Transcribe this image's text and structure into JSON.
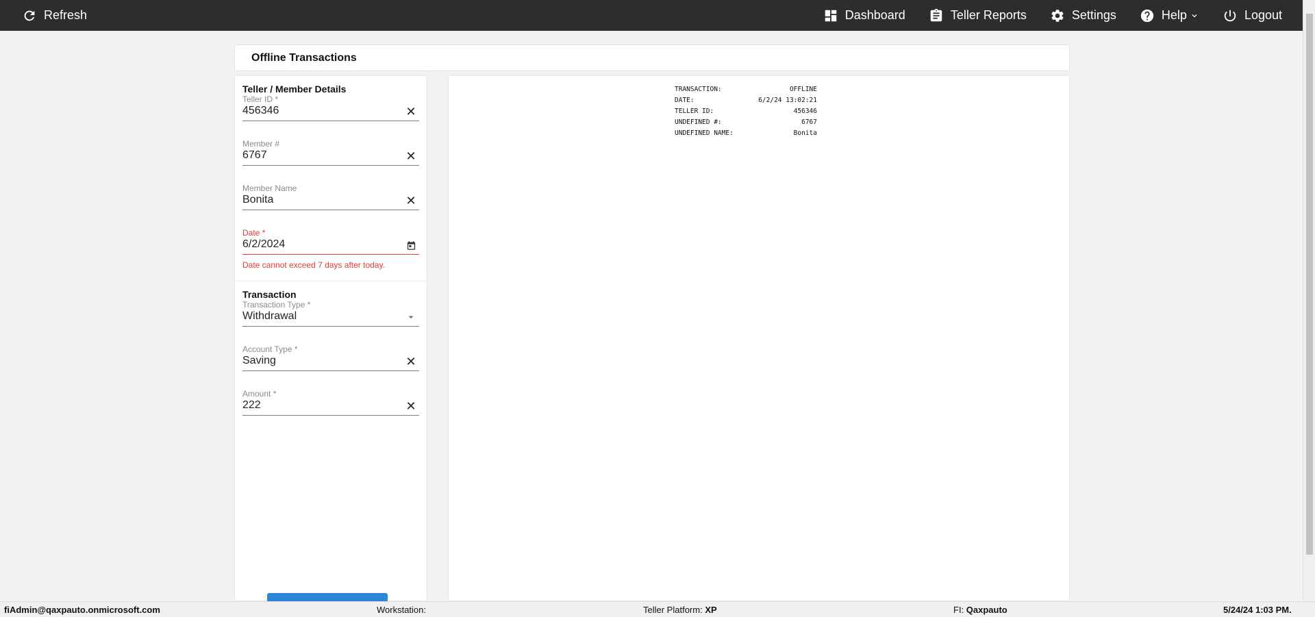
{
  "topbar": {
    "refresh_label": "Refresh",
    "dashboard_label": "Dashboard",
    "teller_reports_label": "Teller Reports",
    "settings_label": "Settings",
    "help_label": "Help",
    "logout_label": "Logout"
  },
  "page": {
    "title": "Offline Transactions"
  },
  "member_section": {
    "title": "Teller / Member Details",
    "teller_id": {
      "label": "Teller ID *",
      "value": "456346"
    },
    "member_number": {
      "label": "Member #",
      "value": "6767"
    },
    "member_name": {
      "label": "Member Name",
      "value": "Bonita"
    },
    "date": {
      "label": "Date *",
      "value": "6/2/2024",
      "error": "Date cannot exceed 7 days after today."
    }
  },
  "transaction_section": {
    "title": "Transaction",
    "transaction_type": {
      "label": "Transaction Type *",
      "value": "Withdrawal"
    },
    "account_type": {
      "label": "Account Type *",
      "value": "Saving"
    },
    "amount": {
      "label": "Amount *",
      "value": "222"
    }
  },
  "receipt": {
    "rows": [
      {
        "key": "TRANSACTION:",
        "value": "OFFLINE"
      },
      {
        "key": "DATE:",
        "value": "6/2/24 13:02:21"
      },
      {
        "key": "TELLER ID:",
        "value": "456346"
      },
      {
        "key": "UNDEFINED #:",
        "value": "6767"
      },
      {
        "key": "UNDEFINED NAME:",
        "value": "Bonita"
      }
    ]
  },
  "statusbar": {
    "user": "fiAdmin@qaxpauto.onmicrosoft.com",
    "workstation_label": "Workstation:",
    "workstation_value": "",
    "platform_label": "Teller Platform:",
    "platform_value": "XP",
    "fi_label": "FI:",
    "fi_value": "Qaxpauto",
    "datetime": "5/24/24 1:03 PM."
  },
  "colors": {
    "topbar": "#2d2d2d",
    "error": "#e53935",
    "primary_button": "#2e86d6"
  }
}
